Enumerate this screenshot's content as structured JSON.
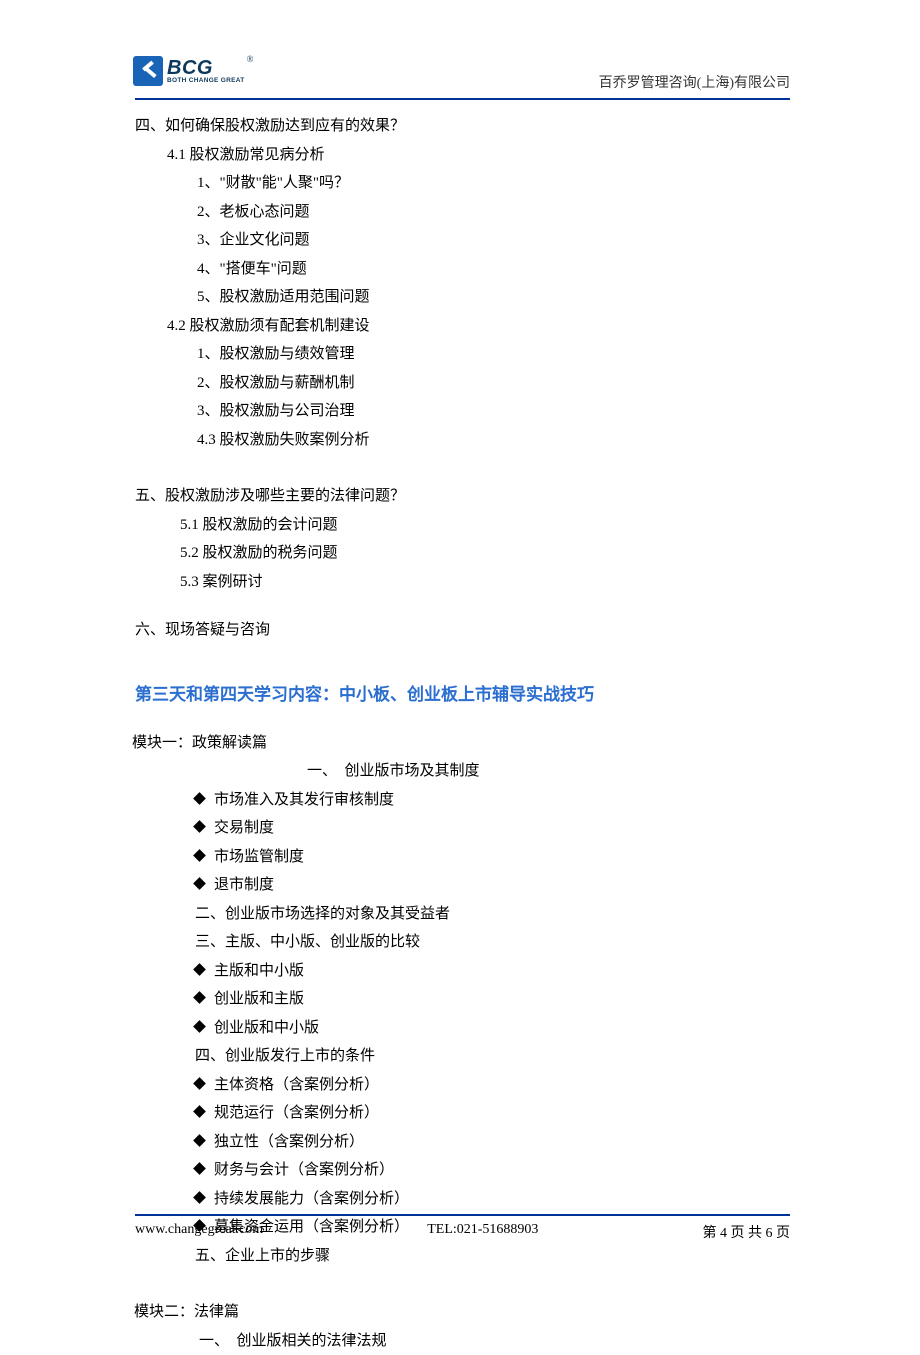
{
  "header": {
    "logo_main": "BCG",
    "logo_sub": "BOTH CHANGE GREAT",
    "reg_mark": "®",
    "company": "百乔罗管理咨询(上海)有限公司"
  },
  "section4": {
    "title": "四、如何确保股权激励达到应有的效果？",
    "s41": "4.1 股权激励常见病分析",
    "s41_1": "1、\"财散\"能\"人聚\"吗？",
    "s41_2": "2、老板心态问题",
    "s41_3": "3、企业文化问题",
    "s41_4": "4、\"搭便车\"问题",
    "s41_5": "5、股权激励适用范围问题",
    "s42": "4.2 股权激励须有配套机制建设",
    "s42_1": "1、股权激励与绩效管理",
    "s42_2": "2、股权激励与薪酬机制",
    "s42_3": "3、股权激励与公司治理",
    "s43": "4.3 股权激励失败案例分析"
  },
  "section5": {
    "title": "五、股权激励涉及哪些主要的法律问题？",
    "s51": "5.1 股权激励的会计问题",
    "s52": "5.2 股权激励的税务问题",
    "s53": "5.3 案例研讨"
  },
  "section6": {
    "title": "六、现场答疑与咨询"
  },
  "blue_heading": "第三天和第四天学习内容：中小板、创业板上市辅导实战技巧",
  "module1": {
    "title": "模块一：政策解读篇",
    "sub1": "一、　创业版市场及其制度",
    "b1": "市场准入及其发行审核制度",
    "b2": "交易制度",
    "b3": "市场监管制度",
    "b4": "退市制度",
    "sub2": "二、创业版市场选择的对象及其受益者",
    "sub3": "三、主版、中小版、创业版的比较",
    "b5": "主版和中小版",
    "b6": "创业版和主版",
    "b7": "创业版和中小版",
    "sub4": "四、创业版发行上市的条件",
    "b8": "主体资格（含案例分析）",
    "b9": "规范运行（含案例分析）",
    "b10": "独立性（含案例分析）",
    "b11": "财务与会计（含案例分析）",
    "b12": "持续发展能力（含案例分析）",
    "b13": "募集资金运用（含案例分析）",
    "sub5": "五、企业上市的步骤"
  },
  "module2": {
    "title": "模块二：法律篇",
    "sub1": "一、　创业版相关的法律法规"
  },
  "footer": {
    "url": "www.changegreat.com",
    "tel": "TEL:021-51688903",
    "page": "第 4 页 共 6 页"
  }
}
